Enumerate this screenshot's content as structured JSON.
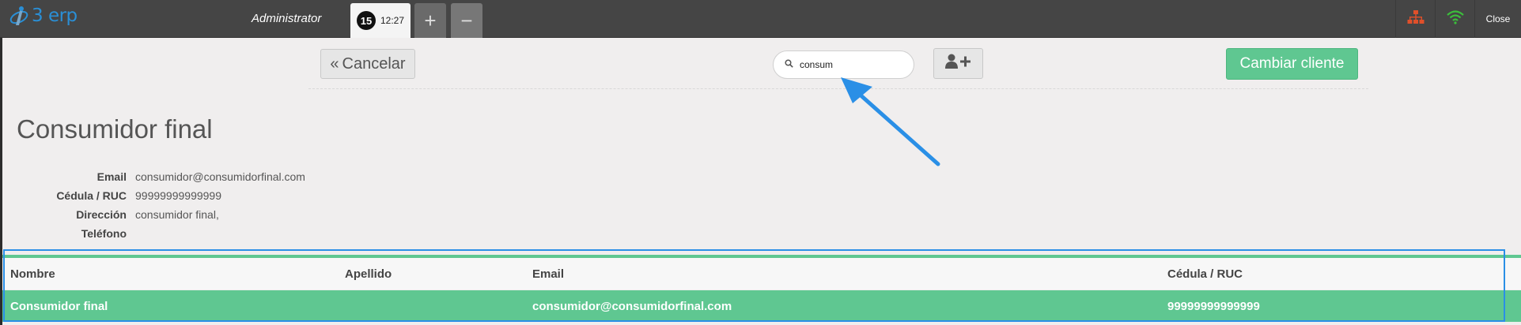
{
  "app": {
    "logo_text": "3 erp",
    "user": "Administrator",
    "order_number": "15",
    "order_time": "12:27",
    "add_tab": "+",
    "remove_tab": "−",
    "close_label": "Close",
    "icons": {
      "network": "sitemap-icon",
      "connection": "wifi-icon"
    }
  },
  "toolbar": {
    "cancel_label": "Cancelar",
    "search_value": "consum",
    "add_customer_icon": "user-plus-icon",
    "change_label": "Cambiar cliente"
  },
  "client": {
    "name": "Consumidor final",
    "fields": [
      {
        "label": "Email",
        "value": "consumidor@consumidorfinal.com"
      },
      {
        "label": "Cédula / RUC",
        "value": "99999999999999"
      },
      {
        "label": "Dirección",
        "value": "consumidor final,"
      },
      {
        "label": "Teléfono",
        "value": ""
      }
    ]
  },
  "table": {
    "headers": {
      "nombre": "Nombre",
      "apellido": "Apellido",
      "email": "Email",
      "ruc": "Cédula / RUC"
    },
    "rows": [
      {
        "nombre": "Consumidor final",
        "apellido": "",
        "email": "consumidor@consumidorfinal.com",
        "ruc": "99999999999999"
      }
    ]
  },
  "colors": {
    "accent_green": "#5fc791",
    "annotation_blue": "#2a8fe6",
    "topbar": "#454545",
    "logo_blue": "#2a8fd6"
  }
}
